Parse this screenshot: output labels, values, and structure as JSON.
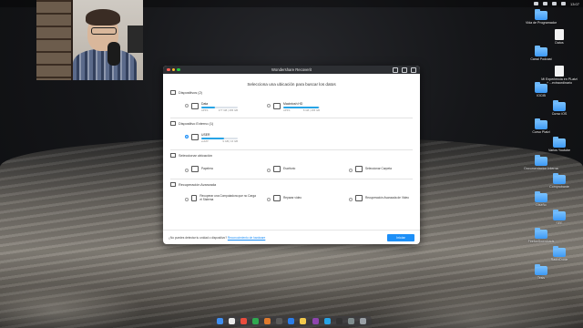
{
  "window": {
    "title": "Wondershare Recoverit",
    "heading": "Selecciona una ubicación para buscar los datos"
  },
  "sections": {
    "internal": {
      "title": "Dispositivos (2)",
      "drives": [
        {
          "name": "Data",
          "fs": "APFS",
          "size": "177 GB | 465 GB",
          "fill": 0.38,
          "selected": false
        },
        {
          "name": "Macintosh HD",
          "fs": "APFS",
          "size": "8 GB | 465 GB",
          "fill": 0.98,
          "selected": false
        }
      ]
    },
    "external": {
      "title": "Dispositivo Externo (1)",
      "drives": [
        {
          "name": "USER",
          "fs": "exFAT",
          "size": "9 GB | 16 GB",
          "fill": 0.62,
          "selected": true
        }
      ]
    },
    "location": {
      "title": "Seleccionar ubicación",
      "options": [
        "Papelera",
        "Escritorio",
        "Seleccionar Carpeta"
      ]
    },
    "advanced": {
      "title": "Recuperación Avanzada",
      "options": [
        "Recuperar una Computadora que no Carga el Sistema",
        "Reparar video",
        "Recuperación Avanzada de Video"
      ]
    }
  },
  "footer": {
    "text": "¿No puedes detectar tu unidad o dispositivo?",
    "link": "Reconocimiento de hardware",
    "start": "Iniciar"
  },
  "desktop_icons": [
    {
      "label": "Vida de Programador",
      "type": "folder"
    },
    {
      "label": "Datos",
      "type": "file"
    },
    {
      "label": "Canal Podcast",
      "type": "folder"
    },
    {
      "label": "Mi Experiencia en PLatzi + ...extraordinario",
      "type": "file"
    },
    {
      "label": "IOCIB",
      "type": "folder"
    },
    {
      "label": "Curso iOS",
      "type": "folder"
    },
    {
      "label": "Curso Platzi",
      "type": "folder"
    },
    {
      "label": "Varios Youtube",
      "type": "folder"
    },
    {
      "label": "Documentacion Interna",
      "type": "folder"
    },
    {
      "label": "Comprobante",
      "type": "folder"
    },
    {
      "label": "Diseño",
      "type": "folder"
    },
    {
      "label": "SEE",
      "type": "folder"
    },
    {
      "label": "FirefoxDownloads",
      "type": "folder"
    },
    {
      "label": "RadioDoble",
      "type": "folder"
    },
    {
      "label": "Tesis",
      "type": "folder"
    }
  ],
  "menubar": {
    "time": "13:07"
  },
  "colors": {
    "accent": "#1d8ff7",
    "bar": "#27a4e6"
  }
}
